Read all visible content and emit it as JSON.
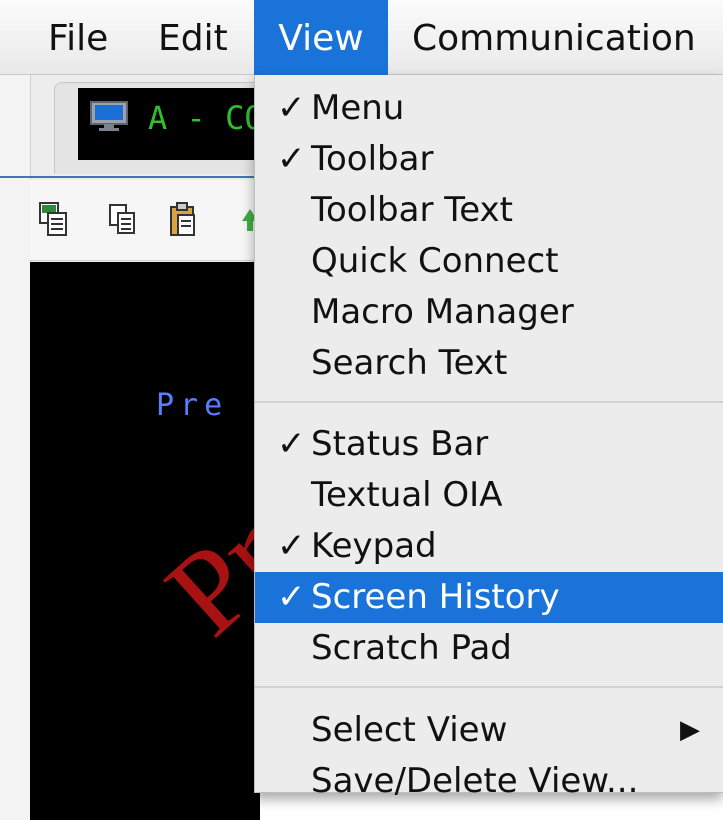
{
  "menubar": {
    "items": [
      "File",
      "Edit",
      "View",
      "Communication"
    ]
  },
  "session": {
    "tab_label": "A - CO",
    "terminal_text": "Pre",
    "watermark": "Pro"
  },
  "colors": {
    "menu_highlight": "#1a73d8",
    "session_text": "#2fbf2f",
    "terminal_text": "#5a7cff",
    "watermark": "#b21414"
  },
  "view_menu": {
    "group1": [
      {
        "label": "Menu",
        "checked": true
      },
      {
        "label": "Toolbar",
        "checked": true
      },
      {
        "label": "Toolbar Text",
        "checked": false
      },
      {
        "label": "Quick Connect",
        "checked": false
      },
      {
        "label": "Macro Manager",
        "checked": false
      },
      {
        "label": "Search Text",
        "checked": false
      }
    ],
    "group2": [
      {
        "label": "Status Bar",
        "checked": true
      },
      {
        "label": "Textual OIA",
        "checked": false
      },
      {
        "label": "Keypad",
        "checked": true
      },
      {
        "label": "Screen History",
        "checked": true,
        "highlighted": true
      },
      {
        "label": "Scratch Pad",
        "checked": false
      }
    ],
    "group3": [
      {
        "label": "Select View",
        "checked": false,
        "submenu": true
      },
      {
        "label": "Save/Delete View...",
        "checked": false
      }
    ],
    "check_glyph": "✓",
    "submenu_glyph": "▶"
  }
}
